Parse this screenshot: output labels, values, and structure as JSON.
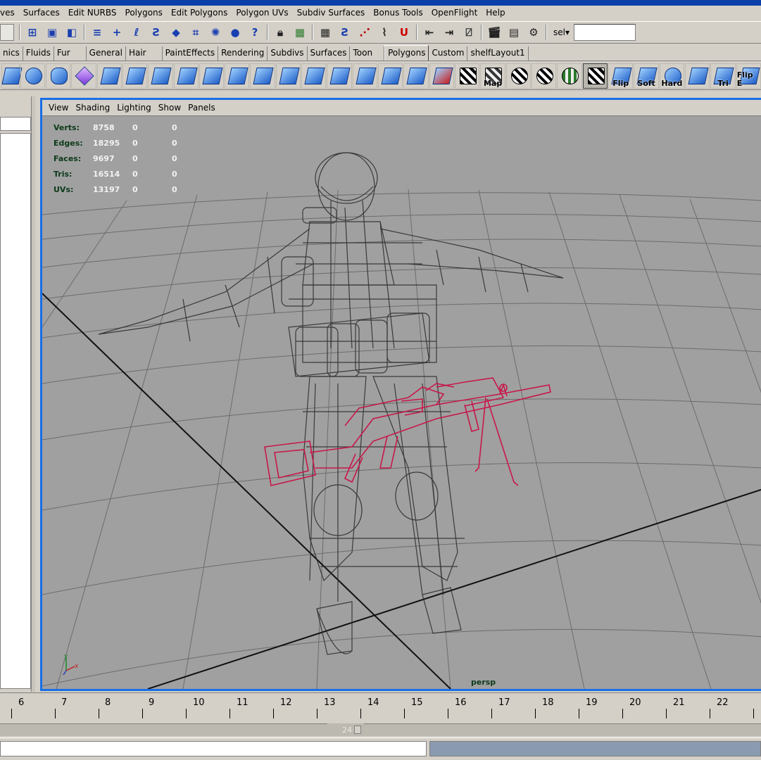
{
  "menubar": {
    "items": [
      "ves",
      "Surfaces",
      "Edit NURBS",
      "Polygons",
      "Edit Polygons",
      "Polygon UVs",
      "Subdiv Surfaces",
      "Bonus Tools",
      "OpenFlight",
      "Help"
    ]
  },
  "status_line": {
    "sel_label": "sel▾",
    "sel_value": ""
  },
  "shelf": {
    "tabs": [
      "nics",
      "Fluids",
      "Fur",
      "General",
      "Hair",
      "PaintEffects",
      "Rendering",
      "Subdivs",
      "Surfaces",
      "Toon",
      "Polygons",
      "Custom",
      "shelfLayout1"
    ],
    "active_tab": "Polygons",
    "icon_captions": {
      "map": "Map",
      "flip": "Flip",
      "soft": "Soft",
      "hard": "Hard",
      "tri": "Tri",
      "flip_e": "Flip E"
    }
  },
  "panel": {
    "menu": [
      "View",
      "Shading",
      "Lighting",
      "Show",
      "Panels"
    ],
    "camera": "persp",
    "hud": [
      {
        "label": "Verts:",
        "value": "8758",
        "a": "0",
        "b": "0"
      },
      {
        "label": "Edges:",
        "value": "18295",
        "a": "0",
        "b": "0"
      },
      {
        "label": "Faces:",
        "value": "9697",
        "a": "0",
        "b": "0"
      },
      {
        "label": "Tris:",
        "value": "16514",
        "a": "0",
        "b": "0"
      },
      {
        "label": "UVs:",
        "value": "13197",
        "a": "0",
        "b": "0"
      }
    ],
    "axis": {
      "y": "y",
      "x": "x"
    }
  },
  "timeline": {
    "frames": [
      "6",
      "7",
      "8",
      "9",
      "10",
      "11",
      "12",
      "13",
      "14",
      "15",
      "16",
      "17",
      "18",
      "19",
      "20",
      "21",
      "22"
    ]
  },
  "range_slider": {
    "end_value": "24"
  },
  "colors": {
    "viewport_border": "#1a6ee6",
    "viewport_bg": "#a0a0a0",
    "wire_character": "#2f2f2f",
    "wire_weapon": "#c8174a",
    "hud_label": "#0c3a1a"
  }
}
